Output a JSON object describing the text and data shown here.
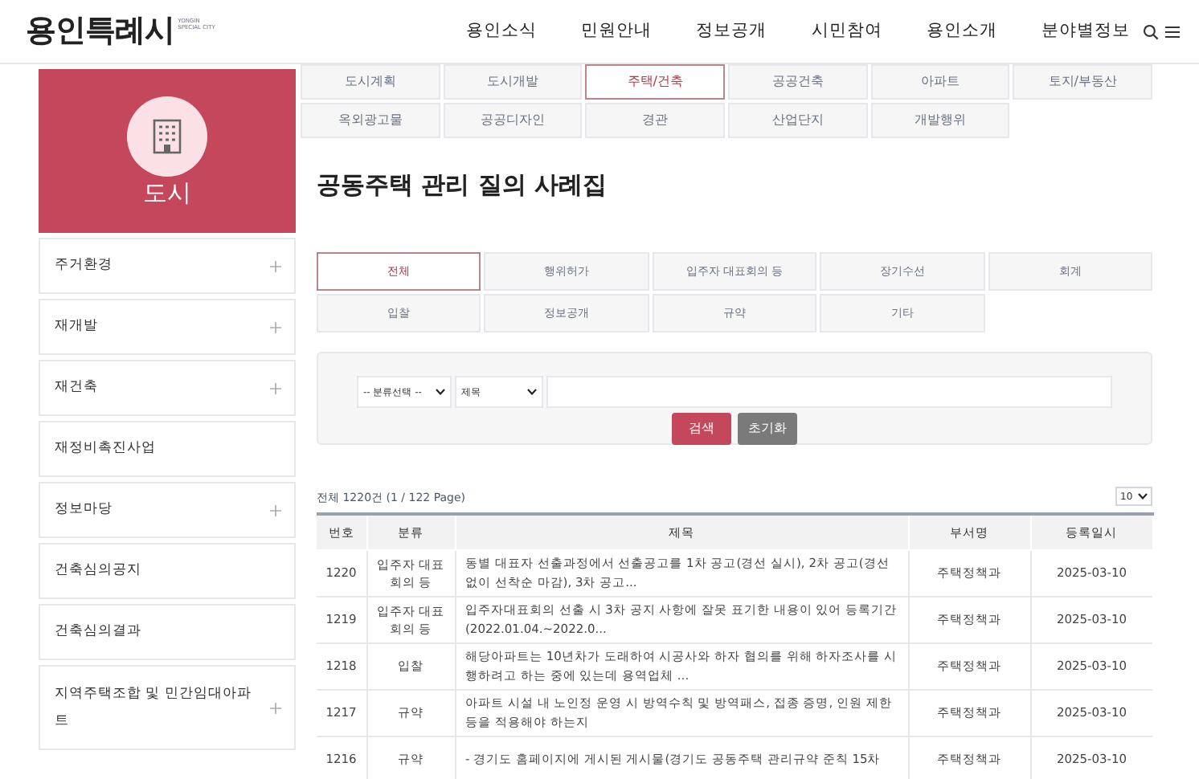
{
  "logo": {
    "name": "용인특례시",
    "subtitle": "YONGIN SPECIAL CITY"
  },
  "nav": [
    "용인소식",
    "민원안내",
    "정보공개",
    "시민참여",
    "용인소개",
    "분야별정보"
  ],
  "sidebar": {
    "title": "도시",
    "items": [
      {
        "label": "주거환경",
        "expandable": true
      },
      {
        "label": "재개발",
        "expandable": true
      },
      {
        "label": "재건축",
        "expandable": true
      },
      {
        "label": "재정비촉진사업",
        "expandable": false
      },
      {
        "label": "정보마당",
        "expandable": true
      },
      {
        "label": "건축심의공지",
        "expandable": false
      },
      {
        "label": "건축심의결과",
        "expandable": false
      },
      {
        "label": "지역주택조합 및 민간임대아파트",
        "expandable": true
      }
    ]
  },
  "category_tabs": [
    {
      "label": "도시계획",
      "selected": false
    },
    {
      "label": "도시개발",
      "selected": false
    },
    {
      "label": "주택/건축",
      "selected": true
    },
    {
      "label": "공공건축",
      "selected": false
    },
    {
      "label": "아파트",
      "selected": false
    },
    {
      "label": "토지/부동산",
      "selected": false
    },
    {
      "label": "옥외광고물",
      "selected": false
    },
    {
      "label": "공공디자인",
      "selected": false
    },
    {
      "label": "경관",
      "selected": false
    },
    {
      "label": "산업단지",
      "selected": false
    },
    {
      "label": "개발행위",
      "selected": false
    }
  ],
  "page_title": "공동주택 관리 질의 사례집",
  "filter_tabs": [
    {
      "label": "전체",
      "selected": true
    },
    {
      "label": "행위허가",
      "selected": false
    },
    {
      "label": "입주자 대표회의 등",
      "selected": false
    },
    {
      "label": "장기수선",
      "selected": false
    },
    {
      "label": "회계",
      "selected": false
    },
    {
      "label": "입찰",
      "selected": false
    },
    {
      "label": "정보공개",
      "selected": false
    },
    {
      "label": "규약",
      "selected": false
    },
    {
      "label": "기타",
      "selected": false
    }
  ],
  "search": {
    "category_select": "-- 분류선택 --",
    "field_select": "제목",
    "search_button": "검색",
    "reset_button": "초기화"
  },
  "summary": "전체 1220건 (1 / 122 Page)",
  "page_size": "10",
  "table": {
    "columns": [
      "번호",
      "분류",
      "제목",
      "부서명",
      "등록일시"
    ],
    "rows": [
      [
        "1220",
        "입주자 대표회의 등",
        "동별 대표자 선출과정에서 선출공고를 1차 공고(경선 실시), 2차 공고(경선 없이 선착순 마감), 3차 공고...",
        "주택정책과",
        "2025-03-10"
      ],
      [
        "1219",
        "입주자 대표회의 등",
        "입주자대표회의 선출 시 3차 공지 사항에 잘못 표기한 내용이 있어 등록기간(2022.01.04.~2022.0...",
        "주택정책과",
        "2025-03-10"
      ],
      [
        "1218",
        "입찰",
        "해당아파트는 10년차가 도래하여 시공사와 하자 협의를 위해 하자조사를 시행하려고 하는 중에 있는데 용역업체 ...",
        "주택정책과",
        "2025-03-10"
      ],
      [
        "1217",
        "규약",
        "아파트 시설 내 노인정 운영 시 방역수칙 및 방역패스, 접종 증명, 인원 제한 등을 적용해야 하는지",
        "주택정책과",
        "2025-03-10"
      ],
      [
        "1216",
        "규약",
        "- 경기도 홈페이지에 게시된 게시물(경기도 공동주택 관리규약 준칙 15차",
        "주택정책과",
        "2025-03-10"
      ]
    ]
  }
}
